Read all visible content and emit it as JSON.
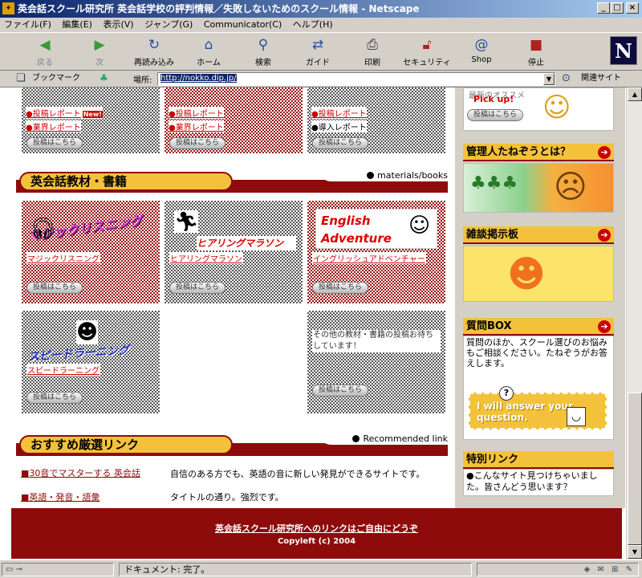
{
  "window": {
    "title": "英会話スクール研究所  英会話学校の評判情報／失敗しないためのスクール情報 - Netscape",
    "min": "_",
    "max": "□",
    "close": "×"
  },
  "menu": [
    "ファイル(F)",
    "編集(E)",
    "表示(V)",
    "ジャンプ(G)",
    "Communicator(C)",
    "ヘルプ(H)"
  ],
  "toolbar": {
    "back": "戻る",
    "forward": "次",
    "reload": "再読み込み",
    "home": "ホーム",
    "search": "検索",
    "guide": "ガイド",
    "print": "印刷",
    "security": "セキュリティ",
    "shop": "Shop",
    "stop": "停止",
    "logo": "N"
  },
  "location": {
    "bookmarks": "ブックマーク",
    "label": "場所:",
    "url": "http://nokko.dip.jp/",
    "related": "関連サイト"
  },
  "post_button": "投稿はこちら",
  "top_row": [
    {
      "l1": "●投稿レポート",
      "new": "New!",
      "l2": "●業界レポート"
    },
    {
      "l1": "●投稿レポート",
      "new": "",
      "l2": "●業界レポート"
    },
    {
      "l1": "●投稿レポート",
      "new": "",
      "l2": "●導入レポート"
    }
  ],
  "sections": {
    "books": {
      "title": "英会話教材・書籍",
      "tag": "materials/books"
    },
    "links": {
      "title": "おすすめ厳選リンク",
      "tag": "Recommended link"
    }
  },
  "books": [
    {
      "title": "マジックリスニング",
      "sub": "マジックリスニング"
    },
    {
      "title": "ヒアリングマラソン",
      "sub": "ヒアリングマラソン"
    },
    {
      "title": "English Adventure",
      "sub": "イングリッシュアドベンチャー"
    },
    {
      "title": "スピードラーニング",
      "sub": "スピードラーニング"
    },
    {
      "title": "",
      "sub": ""
    },
    {
      "title": "",
      "sub": "その他の教材・書籍の投稿お待ちしています！"
    }
  ],
  "sidebar": {
    "pickup": {
      "text": "Pick up!",
      "top_text": "最新のオススメ"
    },
    "about": {
      "title": "管理人たねぞうとは？"
    },
    "bbs": {
      "title": "雑談掲示板"
    },
    "qbox": {
      "title": "質問BOX",
      "desc": "質問のほか、スクール選びのお悩みもご相談ください。たねぞうがお答えします。",
      "banner": "I will answer your question."
    },
    "special": {
      "title": "特別リンク",
      "desc": "●こんなサイト見つけちゃいました。皆さんどう思います？"
    }
  },
  "recommended": [
    {
      "label": "■30音でマスターする 英会話",
      "desc": "自信のある方でも、英語の音に新しい発見ができるサイトです。"
    },
    {
      "label": "■英語・発音・語彙",
      "desc": "タイトルの通り。強烈です。"
    }
  ],
  "footer": {
    "link": "英会話スクール研究所へのリンクはご自由にどうぞ",
    "copy": "Copyleft (c) 2004"
  },
  "status": {
    "text": "ドキュメント: 完了。"
  },
  "colors": {
    "accent": "#8e0b0b",
    "pill": "#f3c23a",
    "titlebar": "#0a246a"
  }
}
